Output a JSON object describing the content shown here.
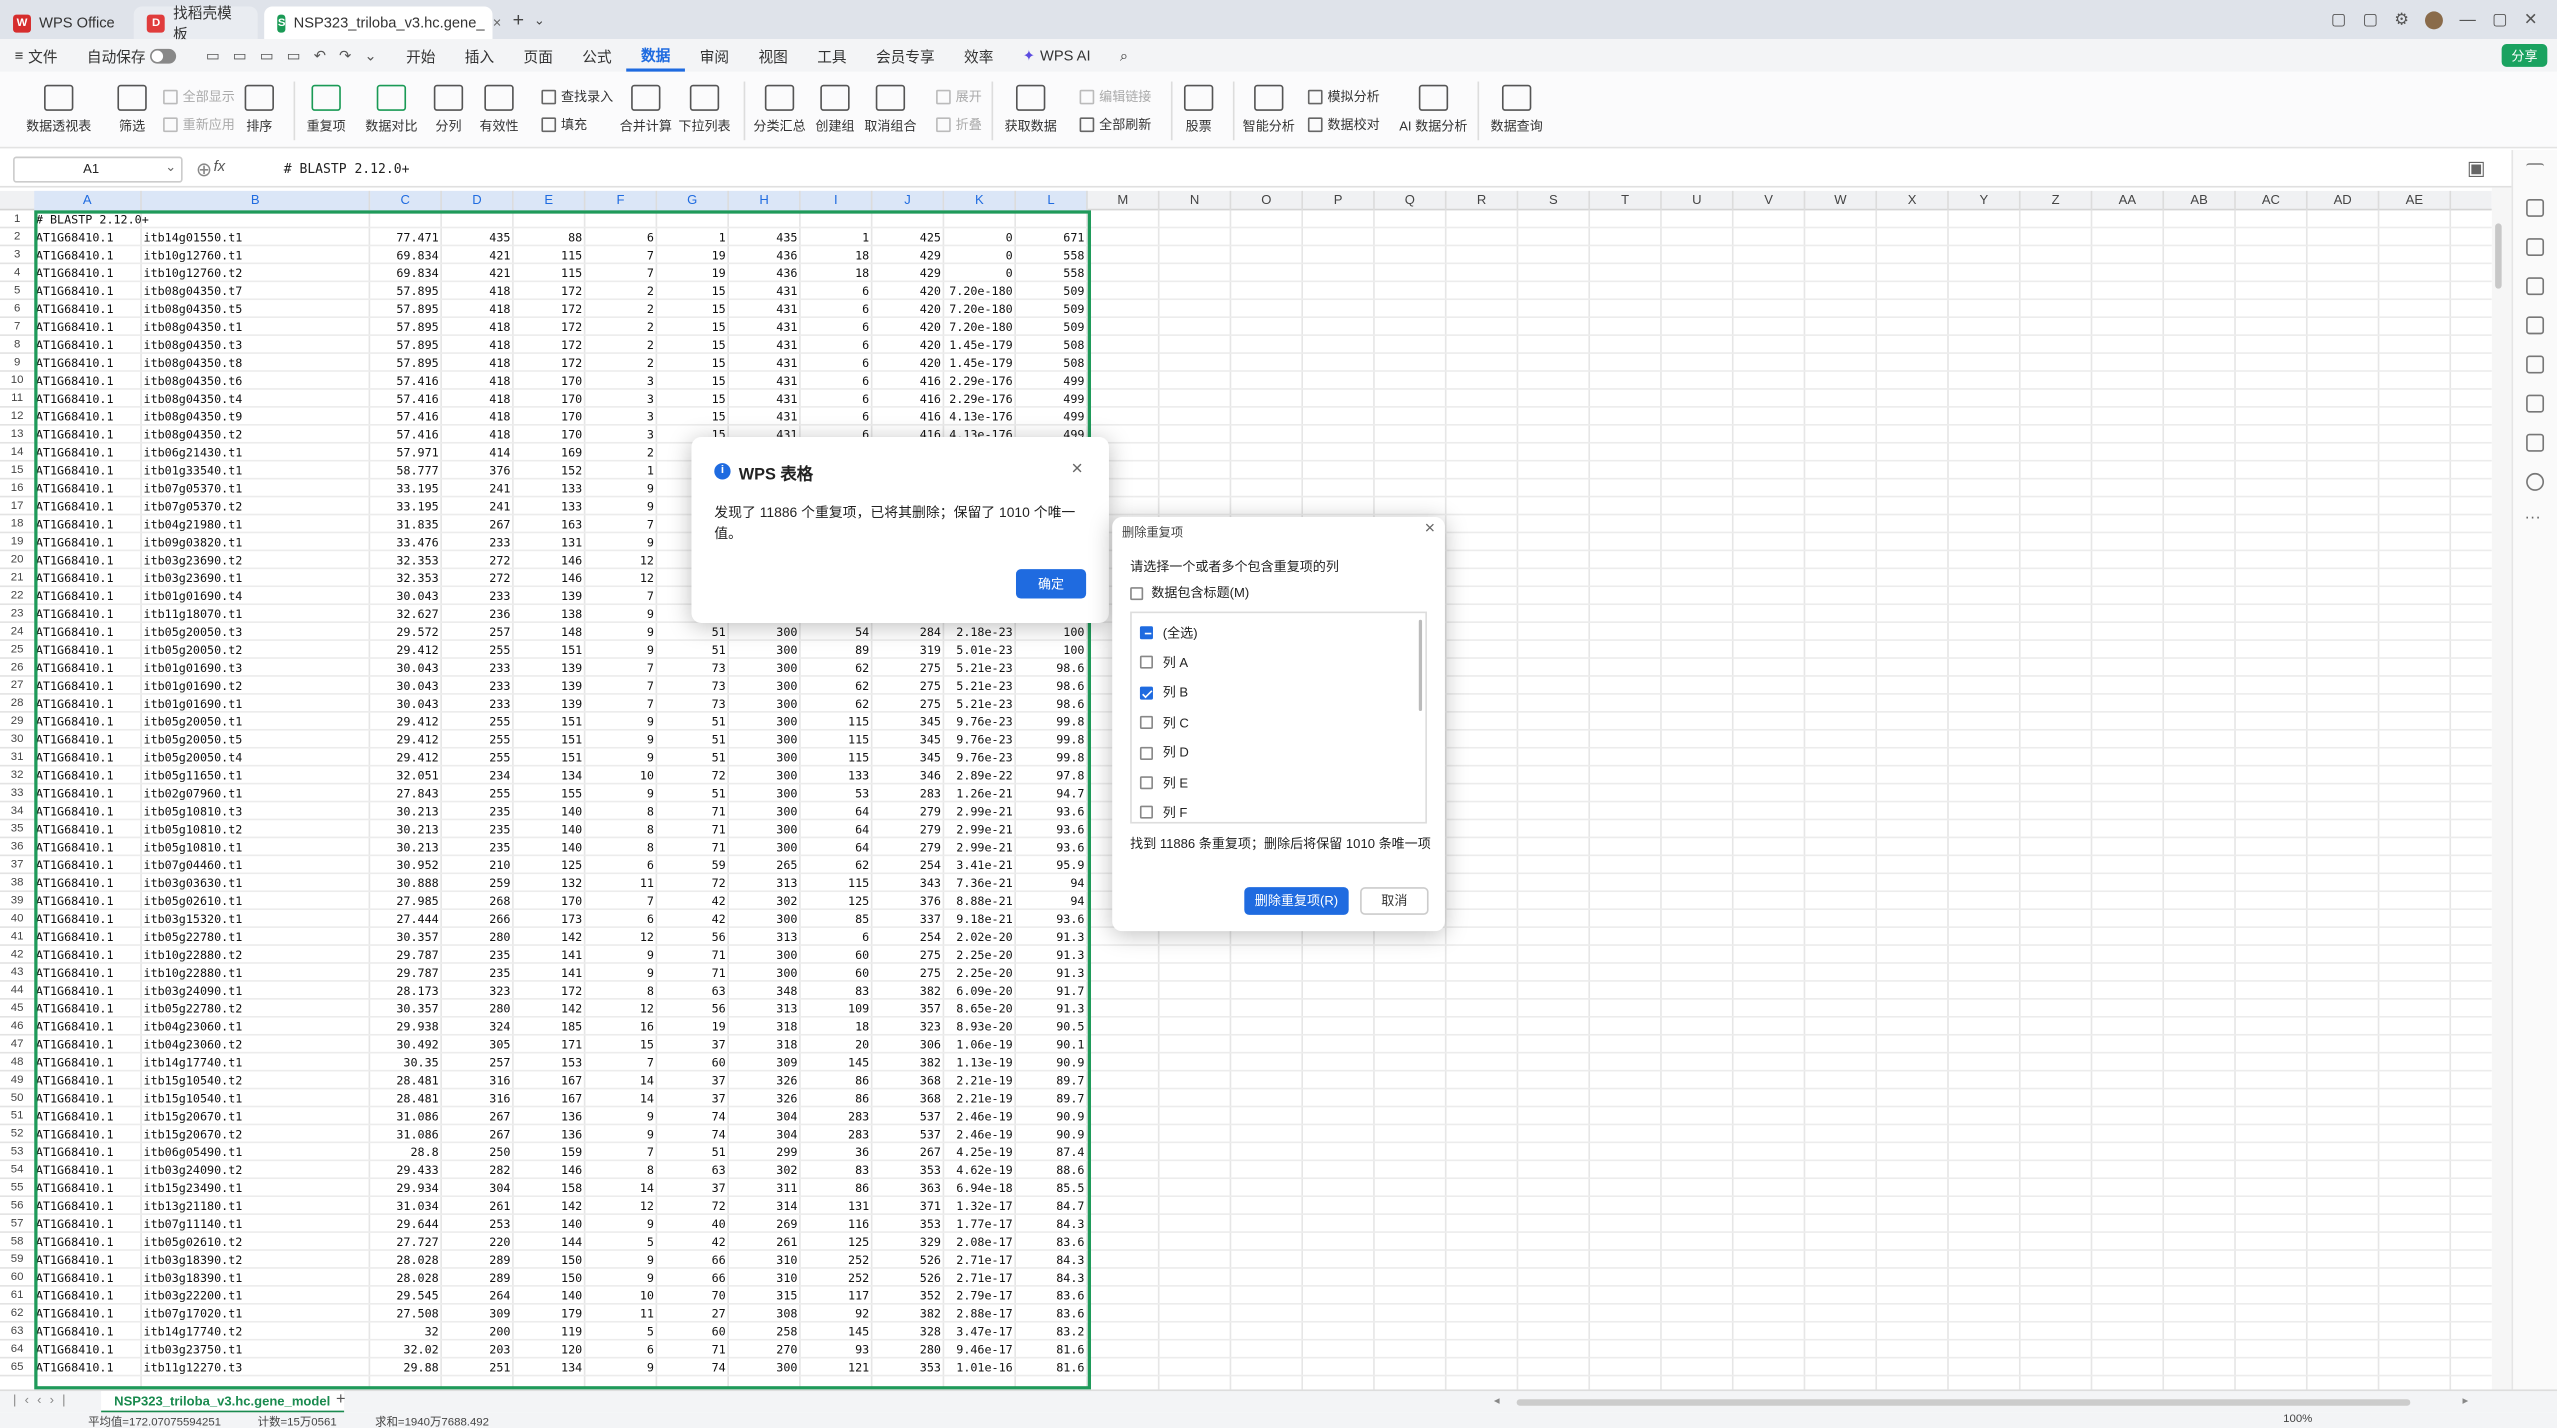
{
  "tabs": {
    "wps_office": "WPS Office",
    "template": "找稻壳模板",
    "file": "NSP323_triloba_v3.hc.gene_"
  },
  "menu": {
    "file": "文件",
    "autosave": "自动保存",
    "items": [
      "开始",
      "插入",
      "页面",
      "公式",
      "数据",
      "审阅",
      "视图",
      "工具",
      "会员专享",
      "效率"
    ],
    "wps_ai": "WPS AI",
    "share": "分享"
  },
  "ribbon": {
    "pivot": "数据透视表",
    "filter": "筛选",
    "show_all": "全部显示",
    "reapply": "重新应用",
    "sort": "排序",
    "duplicates": "重复项",
    "compare": "数据对比",
    "split": "分列",
    "validity": "有效性",
    "lookup": "查找录入",
    "fill": "填充",
    "merge_calc": "合并计算",
    "dropdown": "下拉列表",
    "subtotal": "分类汇总",
    "group": "创建组",
    "ungroup": "取消组合",
    "expand": "展开",
    "collapse": "折叠",
    "get_data": "获取数据",
    "edit_links": "编辑链接",
    "refresh_all": "全部刷新",
    "stocks": "股票",
    "smart_analysis": "智能分析",
    "what_if": "模拟分析",
    "data_check": "数据校对",
    "ai_analysis": "AI 数据分析",
    "data_query": "数据查询"
  },
  "formula_bar": {
    "cell_ref": "A1",
    "fx": "fx",
    "content": "# BLASTP 2.12.0+"
  },
  "columns": [
    "A",
    "B",
    "C",
    "D",
    "E",
    "F",
    "G",
    "H",
    "I",
    "J",
    "K",
    "L",
    "M",
    "N",
    "O",
    "P",
    "Q",
    "R",
    "S",
    "T",
    "U",
    "V",
    "W",
    "X",
    "Y",
    "Z",
    "AA",
    "AB",
    "AC",
    "AD",
    "AE"
  ],
  "rows": [
    [
      "# BLASTP 2.12.0+",
      "",
      "",
      "",
      "",
      "",
      "",
      "",
      "",
      "",
      "",
      ""
    ],
    [
      "AT1G68410.1",
      "itb14g01550.t1",
      "77.471",
      "435",
      "88",
      "6",
      "1",
      "435",
      "1",
      "425",
      "0",
      "671"
    ],
    [
      "AT1G68410.1",
      "itb10g12760.t1",
      "69.834",
      "421",
      "115",
      "7",
      "19",
      "436",
      "18",
      "429",
      "0",
      "558"
    ],
    [
      "AT1G68410.1",
      "itb10g12760.t2",
      "69.834",
      "421",
      "115",
      "7",
      "19",
      "436",
      "18",
      "429",
      "0",
      "558"
    ],
    [
      "AT1G68410.1",
      "itb08g04350.t7",
      "57.895",
      "418",
      "172",
      "2",
      "15",
      "431",
      "6",
      "420",
      "7.20e-180",
      "509"
    ],
    [
      "AT1G68410.1",
      "itb08g04350.t5",
      "57.895",
      "418",
      "172",
      "2",
      "15",
      "431",
      "6",
      "420",
      "7.20e-180",
      "509"
    ],
    [
      "AT1G68410.1",
      "itb08g04350.t1",
      "57.895",
      "418",
      "172",
      "2",
      "15",
      "431",
      "6",
      "420",
      "7.20e-180",
      "509"
    ],
    [
      "AT1G68410.1",
      "itb08g04350.t3",
      "57.895",
      "418",
      "172",
      "2",
      "15",
      "431",
      "6",
      "420",
      "1.45e-179",
      "508"
    ],
    [
      "AT1G68410.1",
      "itb08g04350.t8",
      "57.895",
      "418",
      "172",
      "2",
      "15",
      "431",
      "6",
      "420",
      "1.45e-179",
      "508"
    ],
    [
      "AT1G68410.1",
      "itb08g04350.t6",
      "57.416",
      "418",
      "170",
      "3",
      "15",
      "431",
      "6",
      "416",
      "2.29e-176",
      "499"
    ],
    [
      "AT1G68410.1",
      "itb08g04350.t4",
      "57.416",
      "418",
      "170",
      "3",
      "15",
      "431",
      "6",
      "416",
      "2.29e-176",
      "499"
    ],
    [
      "AT1G68410.1",
      "itb08g04350.t9",
      "57.416",
      "418",
      "170",
      "3",
      "15",
      "431",
      "6",
      "416",
      "4.13e-176",
      "499"
    ],
    [
      "AT1G68410.1",
      "itb08g04350.t2",
      "57.416",
      "418",
      "170",
      "3",
      "15",
      "431",
      "6",
      "416",
      "4.13e-176",
      "499"
    ],
    [
      "AT1G68410.1",
      "itb06g21430.t1",
      "57.971",
      "414",
      "169",
      "2",
      "",
      "",
      "",
      "",
      "",
      ""
    ],
    [
      "AT1G68410.1",
      "itb01g33540.t1",
      "58.777",
      "376",
      "152",
      "1",
      "",
      "",
      "",
      "",
      "",
      ""
    ],
    [
      "AT1G68410.1",
      "itb07g05370.t1",
      "33.195",
      "241",
      "133",
      "9",
      "",
      "",
      "",
      "",
      "",
      ""
    ],
    [
      "AT1G68410.1",
      "itb07g05370.t2",
      "33.195",
      "241",
      "133",
      "9",
      "",
      "",
      "",
      "",
      "",
      ""
    ],
    [
      "AT1G68410.1",
      "itb04g21980.t1",
      "31.835",
      "267",
      "163",
      "7",
      "",
      "",
      "",
      "",
      "",
      ""
    ],
    [
      "AT1G68410.1",
      "itb09g03820.t1",
      "33.476",
      "233",
      "131",
      "9",
      "",
      "",
      "",
      "",
      "",
      ""
    ],
    [
      "AT1G68410.1",
      "itb03g23690.t2",
      "32.353",
      "272",
      "146",
      "12",
      "",
      "",
      "",
      "",
      "",
      ""
    ],
    [
      "AT1G68410.1",
      "itb03g23690.t1",
      "32.353",
      "272",
      "146",
      "12",
      "",
      "",
      "",
      "",
      "",
      ""
    ],
    [
      "AT1G68410.1",
      "itb01g01690.t4",
      "30.043",
      "233",
      "139",
      "7",
      "",
      "",
      "",
      "",
      "",
      ""
    ],
    [
      "AT1G68410.1",
      "itb11g18070.t1",
      "32.627",
      "236",
      "138",
      "9",
      "",
      "",
      "",
      "",
      "",
      ""
    ],
    [
      "AT1G68410.1",
      "itb05g20050.t3",
      "29.572",
      "257",
      "148",
      "9",
      "51",
      "300",
      "54",
      "284",
      "2.18e-23",
      "100"
    ],
    [
      "AT1G68410.1",
      "itb05g20050.t2",
      "29.412",
      "255",
      "151",
      "9",
      "51",
      "300",
      "89",
      "319",
      "5.01e-23",
      "100"
    ],
    [
      "AT1G68410.1",
      "itb01g01690.t3",
      "30.043",
      "233",
      "139",
      "7",
      "73",
      "300",
      "62",
      "275",
      "5.21e-23",
      "98.6"
    ],
    [
      "AT1G68410.1",
      "itb01g01690.t2",
      "30.043",
      "233",
      "139",
      "7",
      "73",
      "300",
      "62",
      "275",
      "5.21e-23",
      "98.6"
    ],
    [
      "AT1G68410.1",
      "itb01g01690.t1",
      "30.043",
      "233",
      "139",
      "7",
      "73",
      "300",
      "62",
      "275",
      "5.21e-23",
      "98.6"
    ],
    [
      "AT1G68410.1",
      "itb05g20050.t1",
      "29.412",
      "255",
      "151",
      "9",
      "51",
      "300",
      "115",
      "345",
      "9.76e-23",
      "99.8"
    ],
    [
      "AT1G68410.1",
      "itb05g20050.t5",
      "29.412",
      "255",
      "151",
      "9",
      "51",
      "300",
      "115",
      "345",
      "9.76e-23",
      "99.8"
    ],
    [
      "AT1G68410.1",
      "itb05g20050.t4",
      "29.412",
      "255",
      "151",
      "9",
      "51",
      "300",
      "115",
      "345",
      "9.76e-23",
      "99.8"
    ],
    [
      "AT1G68410.1",
      "itb05g11650.t1",
      "32.051",
      "234",
      "134",
      "10",
      "72",
      "300",
      "133",
      "346",
      "2.89e-22",
      "97.8"
    ],
    [
      "AT1G68410.1",
      "itb02g07960.t1",
      "27.843",
      "255",
      "155",
      "9",
      "51",
      "300",
      "53",
      "283",
      "1.26e-21",
      "94.7"
    ],
    [
      "AT1G68410.1",
      "itb05g10810.t3",
      "30.213",
      "235",
      "140",
      "8",
      "71",
      "300",
      "64",
      "279",
      "2.99e-21",
      "93.6"
    ],
    [
      "AT1G68410.1",
      "itb05g10810.t2",
      "30.213",
      "235",
      "140",
      "8",
      "71",
      "300",
      "64",
      "279",
      "2.99e-21",
      "93.6"
    ],
    [
      "AT1G68410.1",
      "itb05g10810.t1",
      "30.213",
      "235",
      "140",
      "8",
      "71",
      "300",
      "64",
      "279",
      "2.99e-21",
      "93.6"
    ],
    [
      "AT1G68410.1",
      "itb07g04460.t1",
      "30.952",
      "210",
      "125",
      "6",
      "59",
      "265",
      "62",
      "254",
      "3.41e-21",
      "95.9"
    ],
    [
      "AT1G68410.1",
      "itb03g03630.t1",
      "30.888",
      "259",
      "132",
      "11",
      "72",
      "313",
      "115",
      "343",
      "7.36e-21",
      "94"
    ],
    [
      "AT1G68410.1",
      "itb05g02610.t1",
      "27.985",
      "268",
      "170",
      "7",
      "42",
      "302",
      "125",
      "376",
      "8.88e-21",
      "94"
    ],
    [
      "AT1G68410.1",
      "itb03g15320.t1",
      "27.444",
      "266",
      "173",
      "6",
      "42",
      "300",
      "85",
      "337",
      "9.18e-21",
      "93.6"
    ],
    [
      "AT1G68410.1",
      "itb05g22780.t1",
      "30.357",
      "280",
      "142",
      "12",
      "56",
      "313",
      "6",
      "254",
      "2.02e-20",
      "91.3"
    ],
    [
      "AT1G68410.1",
      "itb10g22880.t2",
      "29.787",
      "235",
      "141",
      "9",
      "71",
      "300",
      "60",
      "275",
      "2.25e-20",
      "91.3"
    ],
    [
      "AT1G68410.1",
      "itb10g22880.t1",
      "29.787",
      "235",
      "141",
      "9",
      "71",
      "300",
      "60",
      "275",
      "2.25e-20",
      "91.3"
    ],
    [
      "AT1G68410.1",
      "itb03g24090.t1",
      "28.173",
      "323",
      "172",
      "8",
      "63",
      "348",
      "83",
      "382",
      "6.09e-20",
      "91.7"
    ],
    [
      "AT1G68410.1",
      "itb05g22780.t2",
      "30.357",
      "280",
      "142",
      "12",
      "56",
      "313",
      "109",
      "357",
      "8.65e-20",
      "91.3"
    ],
    [
      "AT1G68410.1",
      "itb04g23060.t1",
      "29.938",
      "324",
      "185",
      "16",
      "19",
      "318",
      "18",
      "323",
      "8.93e-20",
      "90.5"
    ],
    [
      "AT1G68410.1",
      "itb04g23060.t2",
      "30.492",
      "305",
      "171",
      "15",
      "37",
      "318",
      "20",
      "306",
      "1.06e-19",
      "90.1"
    ],
    [
      "AT1G68410.1",
      "itb14g17740.t1",
      "30.35",
      "257",
      "153",
      "7",
      "60",
      "309",
      "145",
      "382",
      "1.13e-19",
      "90.9"
    ],
    [
      "AT1G68410.1",
      "itb15g10540.t2",
      "28.481",
      "316",
      "167",
      "14",
      "37",
      "326",
      "86",
      "368",
      "2.21e-19",
      "89.7"
    ],
    [
      "AT1G68410.1",
      "itb15g10540.t1",
      "28.481",
      "316",
      "167",
      "14",
      "37",
      "326",
      "86",
      "368",
      "2.21e-19",
      "89.7"
    ],
    [
      "AT1G68410.1",
      "itb15g20670.t1",
      "31.086",
      "267",
      "136",
      "9",
      "74",
      "304",
      "283",
      "537",
      "2.46e-19",
      "90.9"
    ],
    [
      "AT1G68410.1",
      "itb15g20670.t2",
      "31.086",
      "267",
      "136",
      "9",
      "74",
      "304",
      "283",
      "537",
      "2.46e-19",
      "90.9"
    ],
    [
      "AT1G68410.1",
      "itb06g05490.t1",
      "28.8",
      "250",
      "159",
      "7",
      "51",
      "299",
      "36",
      "267",
      "4.25e-19",
      "87.4"
    ],
    [
      "AT1G68410.1",
      "itb03g24090.t2",
      "29.433",
      "282",
      "146",
      "8",
      "63",
      "302",
      "83",
      "353",
      "4.62e-19",
      "88.6"
    ],
    [
      "AT1G68410.1",
      "itb15g23490.t1",
      "29.934",
      "304",
      "158",
      "14",
      "37",
      "311",
      "86",
      "363",
      "6.94e-18",
      "85.5"
    ],
    [
      "AT1G68410.1",
      "itb13g21180.t1",
      "31.034",
      "261",
      "142",
      "12",
      "72",
      "314",
      "131",
      "371",
      "1.32e-17",
      "84.7"
    ],
    [
      "AT1G68410.1",
      "itb07g11140.t1",
      "29.644",
      "253",
      "140",
      "9",
      "40",
      "269",
      "116",
      "353",
      "1.77e-17",
      "84.3"
    ],
    [
      "AT1G68410.1",
      "itb05g02610.t2",
      "27.727",
      "220",
      "144",
      "5",
      "42",
      "261",
      "125",
      "329",
      "2.08e-17",
      "83.6"
    ],
    [
      "AT1G68410.1",
      "itb03g18390.t2",
      "28.028",
      "289",
      "150",
      "9",
      "66",
      "310",
      "252",
      "526",
      "2.71e-17",
      "84.3"
    ],
    [
      "AT1G68410.1",
      "itb03g18390.t1",
      "28.028",
      "289",
      "150",
      "9",
      "66",
      "310",
      "252",
      "526",
      "2.71e-17",
      "84.3"
    ],
    [
      "AT1G68410.1",
      "itb03g22200.t1",
      "29.545",
      "264",
      "140",
      "10",
      "70",
      "315",
      "117",
      "352",
      "2.79e-17",
      "83.6"
    ],
    [
      "AT1G68410.1",
      "itb07g17020.t1",
      "27.508",
      "309",
      "179",
      "11",
      "27",
      "308",
      "92",
      "382",
      "2.88e-17",
      "83.6"
    ],
    [
      "AT1G68410.1",
      "itb14g17740.t2",
      "32",
      "200",
      "119",
      "5",
      "60",
      "258",
      "145",
      "328",
      "3.47e-17",
      "83.2"
    ],
    [
      "AT1G68410.1",
      "itb03g23750.t1",
      "32.02",
      "203",
      "120",
      "6",
      "71",
      "270",
      "93",
      "280",
      "9.46e-17",
      "81.6"
    ],
    [
      "AT1G68410.1",
      "itb11g12270.t3",
      "29.88",
      "251",
      "134",
      "9",
      "74",
      "300",
      "121",
      "353",
      "1.01e-16",
      "81.6"
    ]
  ],
  "sheet": {
    "name": "NSP323_triloba_v3.hc.gene_model"
  },
  "status": {
    "average": "平均值=172.07075594251",
    "count": "计数=15万0561",
    "sum": "求和=1940万7688.492",
    "zoom": "100%"
  },
  "msg_dialog": {
    "title": "WPS 表格",
    "message": "发现了 11886 个重复项，已将其删除；保留了 1010 个唯一值。",
    "ok": "确定"
  },
  "dup_dialog": {
    "title": "删除重复项",
    "instruction": "请选择一个或者多个包含重复项的列",
    "has_header": "数据包含标题(M)",
    "items": [
      {
        "label": "(全选)",
        "state": "partial"
      },
      {
        "label": "列 A",
        "state": "off"
      },
      {
        "label": "列 B",
        "state": "on"
      },
      {
        "label": "列 C",
        "state": "off"
      },
      {
        "label": "列 D",
        "state": "off"
      },
      {
        "label": "列 E",
        "state": "off"
      },
      {
        "label": "列 F",
        "state": "off"
      }
    ],
    "summary": "找到 11886 条重复项；删除后将保留 1010 条唯一项",
    "delete_btn": "删除重复项(R)",
    "cancel_btn": "取消"
  },
  "colors": {
    "accent": "#1f6be0",
    "sheet_green": "#1a8a4f",
    "selection_border": "#1f9a5a"
  }
}
